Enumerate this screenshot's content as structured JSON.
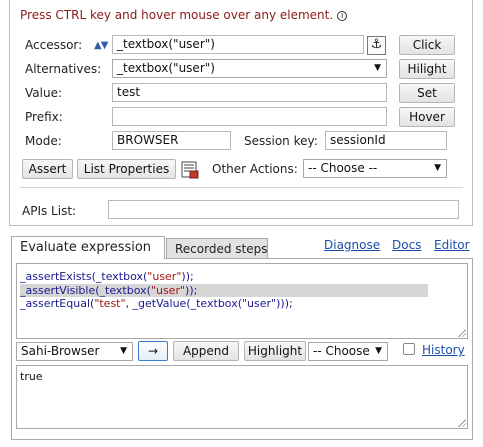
{
  "hint": {
    "text": "Press CTRL key and hover mouse over any element.",
    "info_icon": "①"
  },
  "accessor": {
    "label": "Accessor:",
    "value": "_textbox(\"user\")",
    "click_label": "Click",
    "anchor_icon": "⚓"
  },
  "alternatives": {
    "label": "Alternatives:",
    "selected": "_textbox(\"user\")",
    "hilight_label": "Hilight"
  },
  "value_row": {
    "label": "Value:",
    "value": "test",
    "set_label": "Set"
  },
  "prefix": {
    "label": "Prefix:",
    "value": "",
    "hover_label": "Hover"
  },
  "mode": {
    "label": "Mode:",
    "value": "BROWSER",
    "session_label": "Session key:",
    "session_value": "sessionId"
  },
  "actions": {
    "assert_label": "Assert",
    "list_properties_label": "List Properties",
    "other_actions_label": "Other Actions:",
    "other_actions_selected": "-- Choose --"
  },
  "apis": {
    "label": "APIs List:",
    "value": ""
  },
  "tabs": [
    {
      "label": "Evaluate expression",
      "active": true
    },
    {
      "label": "Recorded steps",
      "active": false
    }
  ],
  "links": {
    "diagnose": "Diagnose",
    "docs": "Docs",
    "editor": "Editor"
  },
  "code_lines": [
    {
      "prefix": "_assertExists(_textbox(",
      "arg": "\"user\"",
      "suffix": "));",
      "selected": false
    },
    {
      "prefix": "_assertVisible(_textbox(",
      "arg": "\"user\"",
      "suffix": "));",
      "selected": true
    },
    {
      "prefix": "_assertEqual(",
      "arg": "\"test\"",
      "suffix": ", _getValue(_textbox(\"user\")));",
      "selected": false
    }
  ],
  "bottom_toolbar": {
    "browser_selected": "Sahi-Browser",
    "run_arrow": "→",
    "append_label": "Append",
    "highlight_label": "Highlight",
    "choose_selected": "-- Choose",
    "history_label": "History",
    "history_checked": false
  },
  "result": {
    "text": "true"
  },
  "colors": {
    "hint": "#8b1a1a",
    "link": "#1d4fa8",
    "code": "#1a1a8c",
    "string": "#a31515"
  }
}
